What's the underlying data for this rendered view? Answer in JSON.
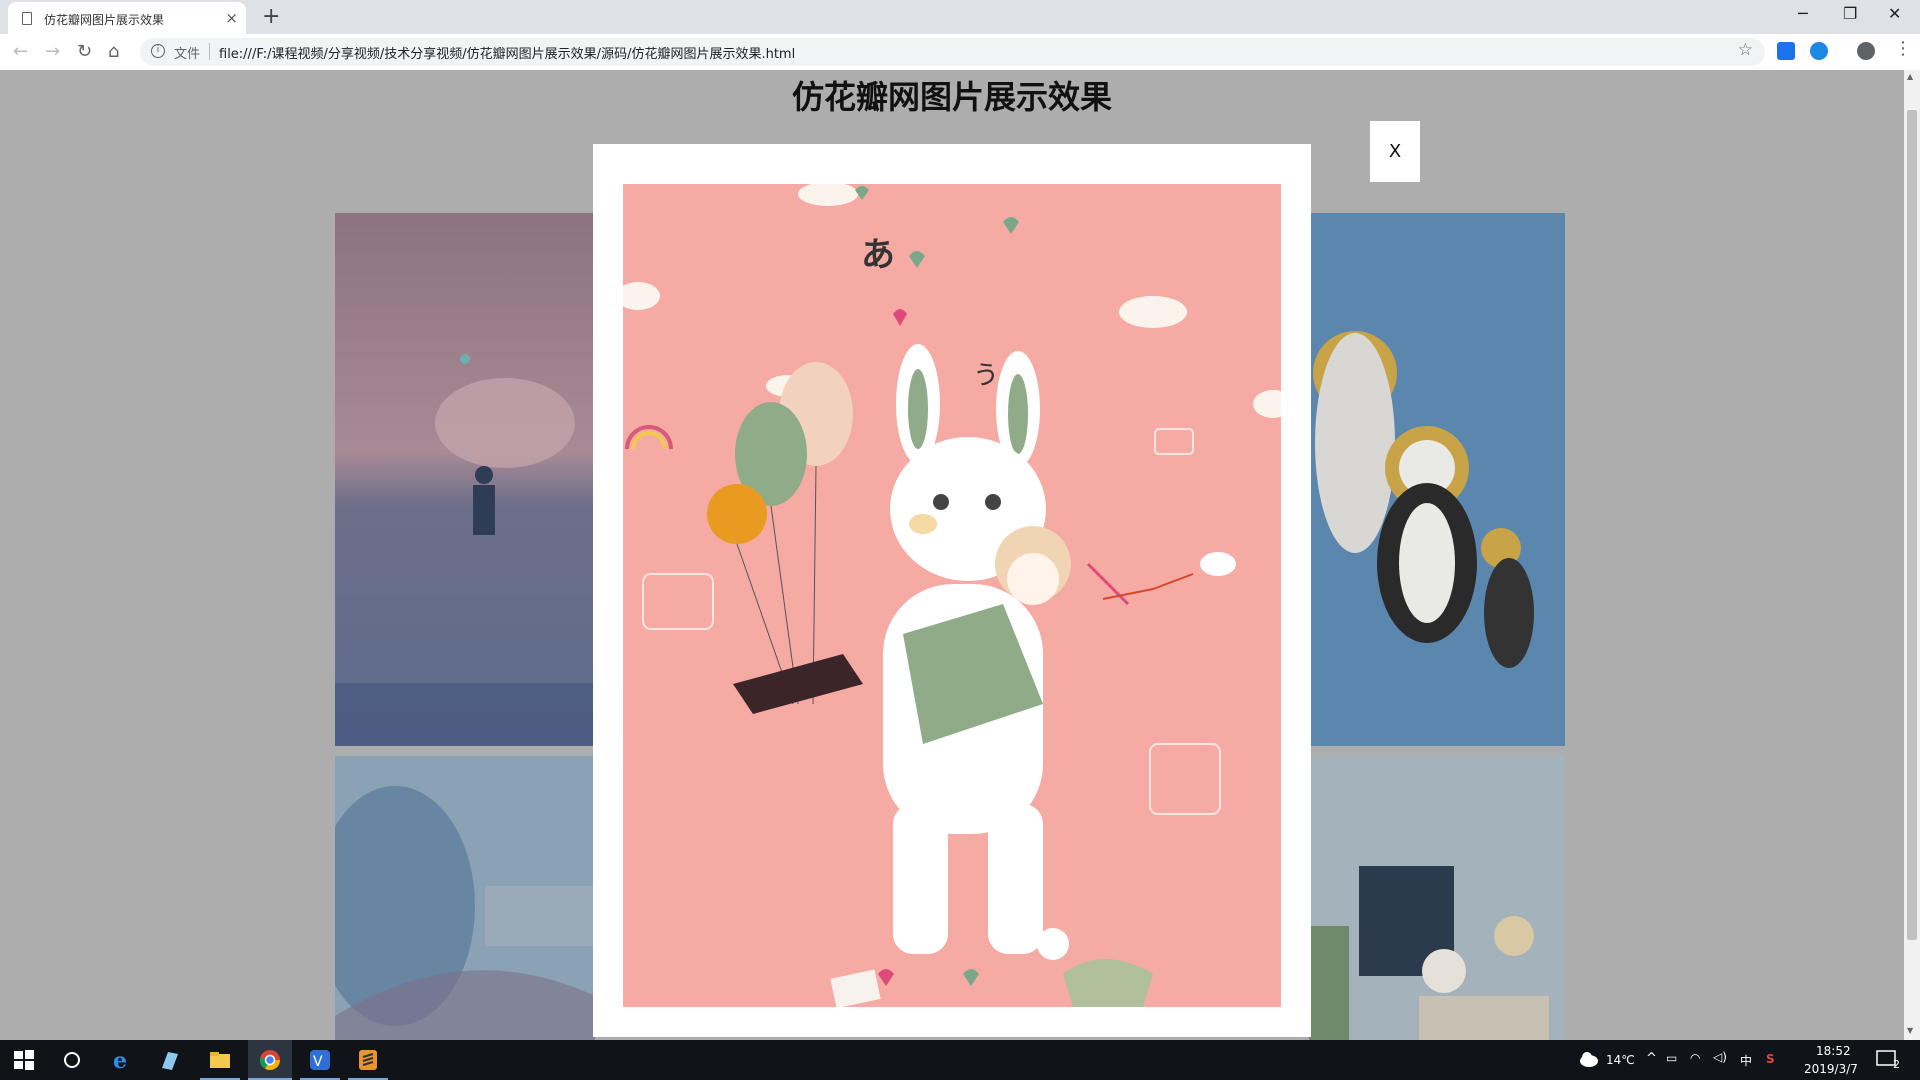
{
  "browser": {
    "tab_title": "仿花瓣网图片展示效果",
    "tab_close": "×",
    "new_tab": "+",
    "url_scheme_label": "文件",
    "url": "file:///F:/课程视频/分享视频/技术分享视频/仿花瓣网图片展示效果/源码/仿花瓣网图片展示效果.html",
    "info_glyph": "i",
    "min_glyph": "─",
    "max_glyph": "❐",
    "close_glyph": "✕",
    "back_glyph": "←",
    "forward_glyph": "→",
    "reload_glyph": "↻",
    "home_glyph": "⌂",
    "star_glyph": "☆",
    "menu_glyph": "⋮"
  },
  "page": {
    "title": "仿花瓣网图片展示效果"
  },
  "modal": {
    "close_label": "X"
  },
  "taskbar": {
    "weather": "14℃",
    "ime": "中",
    "time": "18:52",
    "date": "2019/3/7",
    "notifications": "2"
  },
  "colors": {
    "overlay": "#adadad",
    "modal_bg": "#ffffff",
    "art_bg": "#f5aaa3"
  }
}
